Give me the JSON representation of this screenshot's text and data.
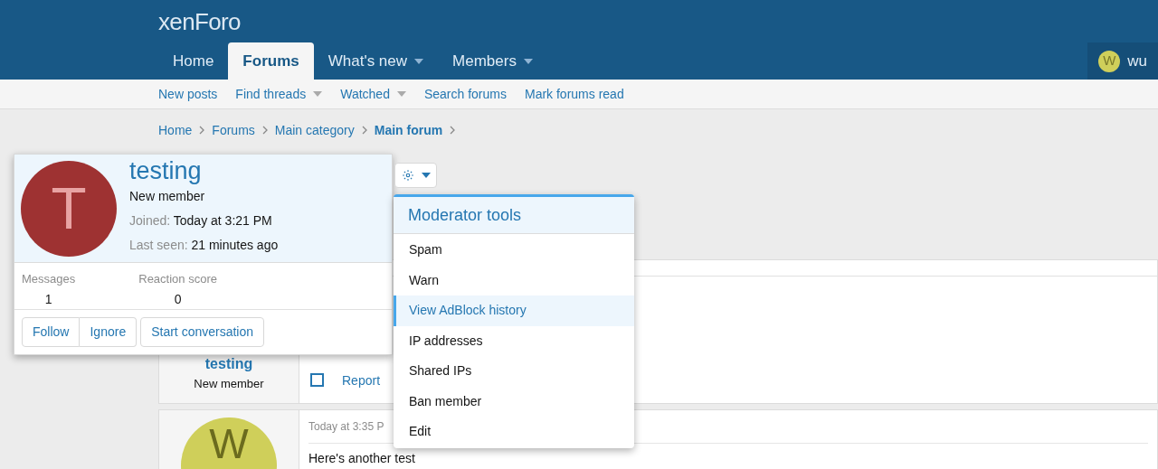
{
  "header": {
    "logo": "xenForo",
    "nav": [
      {
        "label": "Home",
        "selected": false,
        "has_menu": false
      },
      {
        "label": "Forums",
        "selected": true,
        "has_menu": false
      },
      {
        "label": "What's new",
        "selected": false,
        "has_menu": true
      },
      {
        "label": "Members",
        "selected": false,
        "has_menu": true
      }
    ],
    "account": {
      "initial": "W",
      "name": "wu"
    }
  },
  "subnav": [
    {
      "label": "New posts",
      "has_menu": false
    },
    {
      "label": "Find threads",
      "has_menu": true
    },
    {
      "label": "Watched",
      "has_menu": true
    },
    {
      "label": "Search forums",
      "has_menu": false
    },
    {
      "label": "Mark forums read",
      "has_menu": false
    }
  ],
  "breadcrumb": [
    {
      "label": "Home",
      "current": false
    },
    {
      "label": "Forums",
      "current": false
    },
    {
      "label": "Main category",
      "current": false
    },
    {
      "label": "Main forum",
      "current": true
    }
  ],
  "posts": [
    {
      "author": "testing",
      "role": "New member",
      "checked": false,
      "action": "Report"
    },
    {
      "avatar_initial": "W",
      "time": "Today at 3:35 P",
      "body": "Here's another test"
    }
  ],
  "member_tooltip": {
    "initial": "T",
    "name": "testing",
    "title": "New member",
    "facts": [
      {
        "label": "Joined:",
        "value": "Today at 3:21 PM"
      },
      {
        "label": "Last seen:",
        "value": "21 minutes ago"
      }
    ],
    "stats": [
      {
        "label": "Messages",
        "value": "1"
      },
      {
        "label": "Reaction score",
        "value": "0"
      }
    ],
    "buttons": [
      "Follow",
      "Ignore",
      "Start conversation"
    ]
  },
  "moderator_menu": {
    "title": "Moderator tools",
    "items": [
      {
        "label": "Spam",
        "selected": false
      },
      {
        "label": "Warn",
        "selected": false
      },
      {
        "label": "View AdBlock history",
        "selected": true
      },
      {
        "label": "IP addresses",
        "selected": false
      },
      {
        "label": "Shared IPs",
        "selected": false
      },
      {
        "label": "Ban member",
        "selected": false
      },
      {
        "label": "Edit",
        "selected": false
      }
    ]
  }
}
